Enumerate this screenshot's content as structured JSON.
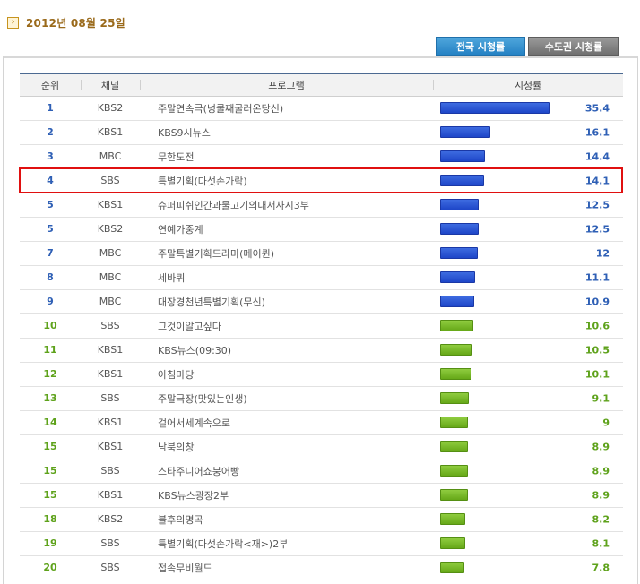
{
  "date": "2012년 08월 25일",
  "date_icon": "arrow-right-icon",
  "tabs": {
    "national": "전국 시청률",
    "capital": "수도권 시청률"
  },
  "headers": {
    "rank": "순위",
    "channel": "채널",
    "program": "프로그램",
    "rating": "시청률"
  },
  "colors": {
    "top_tier": "#2449d0",
    "lower_tier": "#76b62a",
    "highlight": "#e01010"
  },
  "max_rating": 35.4,
  "rows": [
    {
      "rank": "1",
      "channel": "KBS2",
      "program": "주말연속극(넝쿨째굴러온당신)",
      "rating": "35.4",
      "tier": "blue"
    },
    {
      "rank": "2",
      "channel": "KBS1",
      "program": "KBS9시뉴스",
      "rating": "16.1",
      "tier": "blue"
    },
    {
      "rank": "3",
      "channel": "MBC",
      "program": "무한도전",
      "rating": "14.4",
      "tier": "blue"
    },
    {
      "rank": "4",
      "channel": "SBS",
      "program": "특별기획(다섯손가락)",
      "rating": "14.1",
      "tier": "blue"
    },
    {
      "rank": "5",
      "channel": "KBS1",
      "program": "슈퍼피쉬인간과물고기의대서사시3부",
      "rating": "12.5",
      "tier": "blue"
    },
    {
      "rank": "5",
      "channel": "KBS2",
      "program": "연예가중계",
      "rating": "12.5",
      "tier": "blue"
    },
    {
      "rank": "7",
      "channel": "MBC",
      "program": "주말특별기획드라마(메이퀸)",
      "rating": "12",
      "tier": "blue"
    },
    {
      "rank": "8",
      "channel": "MBC",
      "program": "세바퀴",
      "rating": "11.1",
      "tier": "blue"
    },
    {
      "rank": "9",
      "channel": "MBC",
      "program": "대장경천년특별기획(무신)",
      "rating": "10.9",
      "tier": "blue"
    },
    {
      "rank": "10",
      "channel": "SBS",
      "program": "그것이알고싶다",
      "rating": "10.6",
      "tier": "green"
    },
    {
      "rank": "11",
      "channel": "KBS1",
      "program": "KBS뉴스(09:30)",
      "rating": "10.5",
      "tier": "green"
    },
    {
      "rank": "12",
      "channel": "KBS1",
      "program": "아침마당",
      "rating": "10.1",
      "tier": "green"
    },
    {
      "rank": "13",
      "channel": "SBS",
      "program": "주말극장(맛있는인생)",
      "rating": "9.1",
      "tier": "green"
    },
    {
      "rank": "14",
      "channel": "KBS1",
      "program": "걸어서세계속으로",
      "rating": "9",
      "tier": "green"
    },
    {
      "rank": "15",
      "channel": "KBS1",
      "program": "남북의창",
      "rating": "8.9",
      "tier": "green"
    },
    {
      "rank": "15",
      "channel": "SBS",
      "program": "스타주니어쇼붕어빵",
      "rating": "8.9",
      "tier": "green"
    },
    {
      "rank": "15",
      "channel": "KBS1",
      "program": "KBS뉴스광장2부",
      "rating": "8.9",
      "tier": "green"
    },
    {
      "rank": "18",
      "channel": "KBS2",
      "program": "불후의명곡",
      "rating": "8.2",
      "tier": "green"
    },
    {
      "rank": "19",
      "channel": "SBS",
      "program": "특별기획(다섯손가락<재>)2부",
      "rating": "8.1",
      "tier": "green"
    },
    {
      "rank": "20",
      "channel": "SBS",
      "program": "접속무비월드",
      "rating": "7.8",
      "tier": "green"
    }
  ],
  "highlighted_rank": "4"
}
